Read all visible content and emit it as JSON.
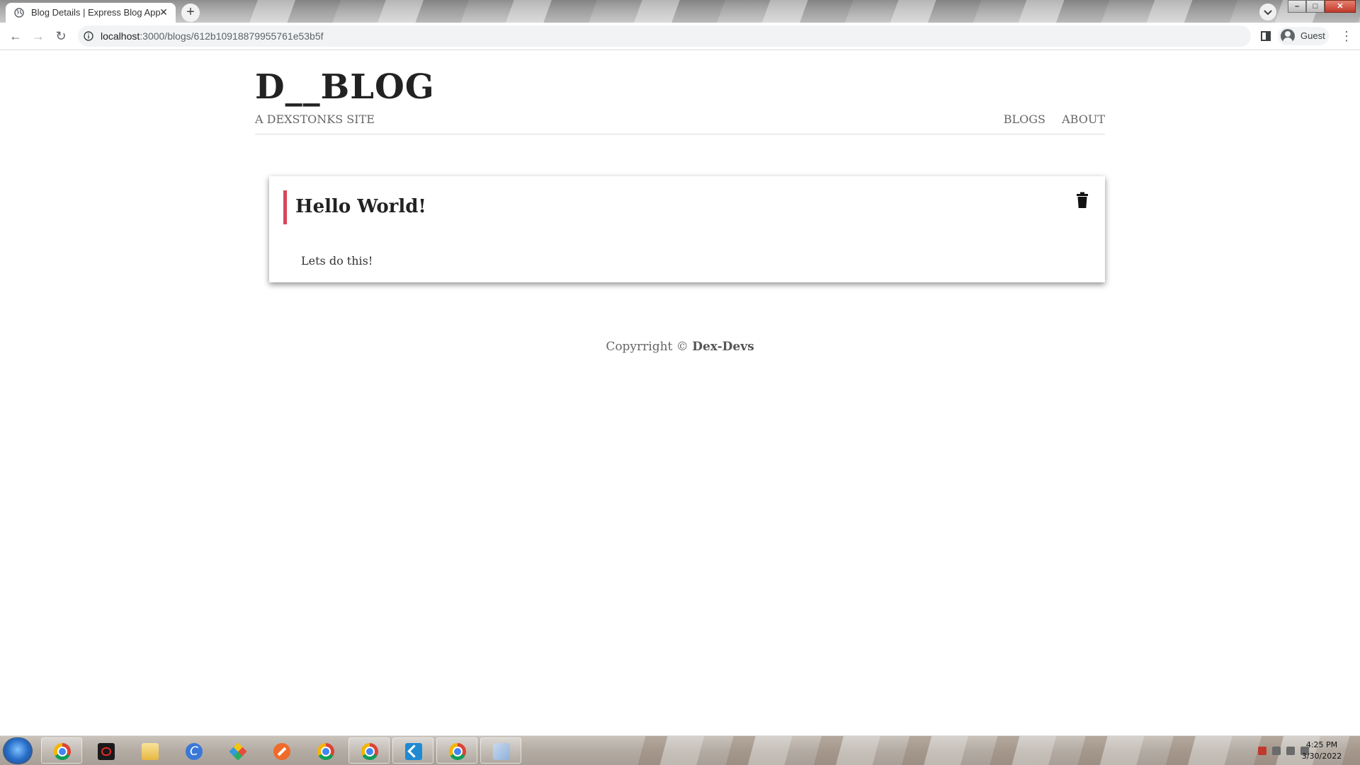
{
  "browser": {
    "tab": {
      "title": "Blog Details | Express Blog App",
      "close": "✕"
    },
    "new_tab": "+",
    "nav": {
      "back": "←",
      "forward": "→",
      "reload": "↻"
    },
    "url": {
      "host": "localhost",
      "path": ":3000/blogs/612b10918879955761e53b5f"
    },
    "profile": "Guest",
    "menu": "⋮",
    "window": {
      "minimize": "–",
      "maximize": "□",
      "close": "✕"
    }
  },
  "site": {
    "title": "D__BLOG",
    "subtitle": "A DEXSTONKS SITE",
    "nav": [
      {
        "label": "BLOGS"
      },
      {
        "label": "ABOUT"
      }
    ]
  },
  "post": {
    "title": "Hello World!",
    "body": "Lets do this!",
    "accent_color": "#d8465a"
  },
  "footer": {
    "text": "Copyrright © ",
    "brand": "Dex-Devs"
  },
  "taskbar": {
    "apps": [
      "chrome",
      "garena",
      "file-explorer",
      "ccleaner",
      "git-gui",
      "sublime",
      "chrome",
      "chrome",
      "vscode",
      "chrome",
      "paint"
    ],
    "clock": {
      "time": "4:25 PM",
      "date": "3/30/2022"
    }
  }
}
